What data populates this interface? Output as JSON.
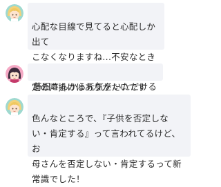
{
  "messages": [
    {
      "avatar": "blonde-girl-avatar-icon",
      "text": "心配な目線で見てると心配しか出て\nこなくなりますね...不安なときこそ肯\n定の声掛けはありがたいです"
    },
    {
      "avatar": "dark-hair-girl-avatar-icon",
      "text": "蒔田さんから元気をいただける♡"
    },
    {
      "avatar": "blonde-girl-avatar-icon",
      "text": "色んなところで、『子供を否定しな\nい・肯定する』って言われてるけど、お\n母さんを否定しない・肯定するって新\n常識でした！"
    }
  ],
  "colors": {
    "bubble_bg": "#f2f3f7",
    "avatar1_bg": "#9fd9cf",
    "avatar2_bg": "#f4a8c4"
  }
}
